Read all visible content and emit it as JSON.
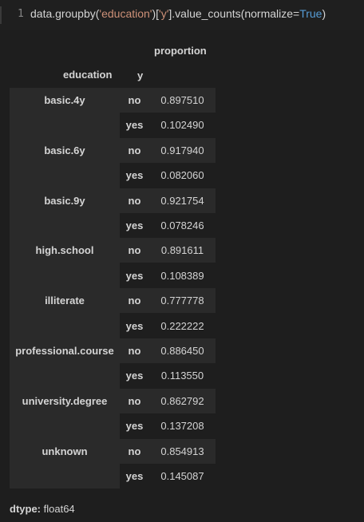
{
  "code_cell": {
    "line_number": "1",
    "code_prefix": "data.groupby(",
    "code_str1": "'education'",
    "code_mid": ")[",
    "code_str2": "'y'",
    "code_mid2": "].value_counts(normalize=",
    "code_kw": "True",
    "code_suffix": ")"
  },
  "table": {
    "value_header": "proportion",
    "index_header_1": "education",
    "index_header_2": "y",
    "groups": [
      {
        "education": "basic.4y",
        "rows": [
          {
            "y": "no",
            "value": "0.897510"
          },
          {
            "y": "yes",
            "value": "0.102490"
          }
        ]
      },
      {
        "education": "basic.6y",
        "rows": [
          {
            "y": "no",
            "value": "0.917940"
          },
          {
            "y": "yes",
            "value": "0.082060"
          }
        ]
      },
      {
        "education": "basic.9y",
        "rows": [
          {
            "y": "no",
            "value": "0.921754"
          },
          {
            "y": "yes",
            "value": "0.078246"
          }
        ]
      },
      {
        "education": "high.school",
        "rows": [
          {
            "y": "no",
            "value": "0.891611"
          },
          {
            "y": "yes",
            "value": "0.108389"
          }
        ]
      },
      {
        "education": "illiterate",
        "rows": [
          {
            "y": "no",
            "value": "0.777778"
          },
          {
            "y": "yes",
            "value": "0.222222"
          }
        ]
      },
      {
        "education": "professional.course",
        "rows": [
          {
            "y": "no",
            "value": "0.886450"
          },
          {
            "y": "yes",
            "value": "0.113550"
          }
        ]
      },
      {
        "education": "university.degree",
        "rows": [
          {
            "y": "no",
            "value": "0.862792"
          },
          {
            "y": "yes",
            "value": "0.137208"
          }
        ]
      },
      {
        "education": "unknown",
        "rows": [
          {
            "y": "no",
            "value": "0.854913"
          },
          {
            "y": "yes",
            "value": "0.145087"
          }
        ]
      }
    ]
  },
  "dtype": {
    "label": "dtype:",
    "value": "float64"
  }
}
